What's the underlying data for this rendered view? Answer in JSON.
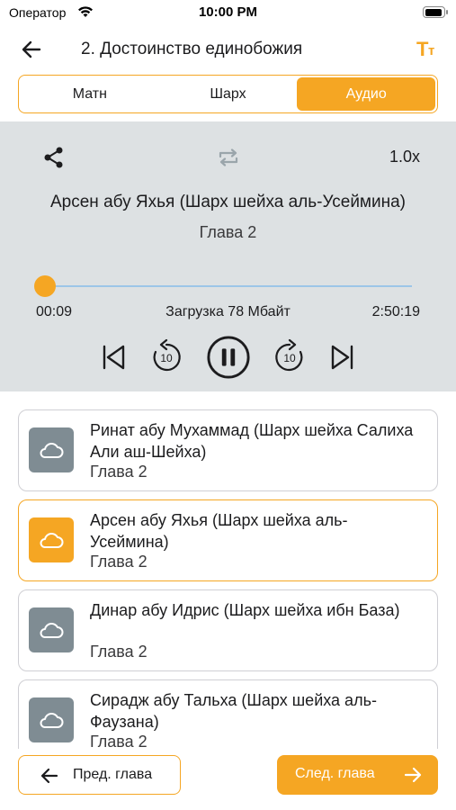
{
  "status_bar": {
    "carrier": "Оператор",
    "time": "10:00 PM"
  },
  "nav": {
    "back_icon": "arrow-left-icon",
    "title": "2. Достоинство единобожия",
    "font_size_icon": "text-size-icon",
    "font_icon_big": "T",
    "font_icon_small": "т"
  },
  "tabs": [
    {
      "label": "Матн",
      "active": false
    },
    {
      "label": "Шарх",
      "active": false
    },
    {
      "label": "Аудио",
      "active": true
    }
  ],
  "player": {
    "share_icon": "share-icon",
    "repeat_icon": "repeat-icon",
    "speed": "1.0x",
    "track_title": "Арсен абу Яхья (Шарх шейха аль-Усеймина)",
    "chapter": "Глава 2",
    "progress_fraction": 0.0009,
    "time_current": "00:09",
    "download_info": "Загрузка 78 Мбайт",
    "time_total": "2:50:19",
    "skip_seconds": "10",
    "state": "playing"
  },
  "recordings": [
    {
      "title": "Ринат абу Мухаммад (Шарх шейха Салиха Али аш-Шейха)",
      "chapter": "Глава 2",
      "active": false
    },
    {
      "title": "Арсен абу Яхья (Шарх шейха аль-Усеймина)",
      "chapter": "Глава 2",
      "active": true
    },
    {
      "title": "Динар абу Идрис (Шарх шейха ибн База)",
      "chapter": "Глава 2",
      "active": false
    },
    {
      "title": "Сирадж абу Тальха (Шарх шейха аль-Фаузана)",
      "chapter": "Глава 2",
      "active": false
    }
  ],
  "footer": {
    "prev_label": "Пред. глава",
    "next_label": "След. глава"
  },
  "colors": {
    "accent": "#f5a623",
    "player_bg": "#dde1e3",
    "cloud_inactive": "#7f8c93",
    "progress_track": "#9cc6e8"
  }
}
